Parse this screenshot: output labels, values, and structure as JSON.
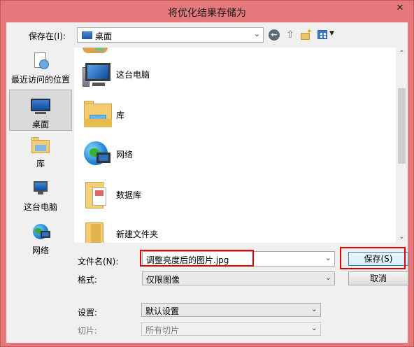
{
  "window": {
    "title": "将优化结果存储为",
    "close_glyph": "✕"
  },
  "top": {
    "save_in_label": "保存在(I):",
    "location": "桌面"
  },
  "places": [
    {
      "label": "最近访问的位置",
      "icon": "recent-locations-icon"
    },
    {
      "label": "桌面",
      "icon": "desktop-icon",
      "selected": true
    },
    {
      "label": "库",
      "icon": "libraries-icon"
    },
    {
      "label": "这台电脑",
      "icon": "this-pc-icon"
    },
    {
      "label": "网络",
      "icon": "network-icon"
    }
  ],
  "files": [
    {
      "name": "这台电脑",
      "icon": "this-pc-icon"
    },
    {
      "name": "库",
      "icon": "libraries-icon"
    },
    {
      "name": "网络",
      "icon": "network-icon"
    },
    {
      "name": "数据库",
      "icon": "folder-icon"
    },
    {
      "name": "新建文件夹",
      "icon": "folder-icon"
    }
  ],
  "form": {
    "filename_label": "文件名(N):",
    "filename_value": "调整亮度后的图片.jpg",
    "type_label": "格式:",
    "type_value": "仅限图像",
    "settings_label": "设置:",
    "settings_value": "默认设置",
    "slices_label": "切片:",
    "slices_value": "所有切片"
  },
  "buttons": {
    "save": "保存(S)",
    "cancel": "取消"
  },
  "colors": {
    "title_bar": "#e5797c",
    "highlight": "#e60000"
  }
}
